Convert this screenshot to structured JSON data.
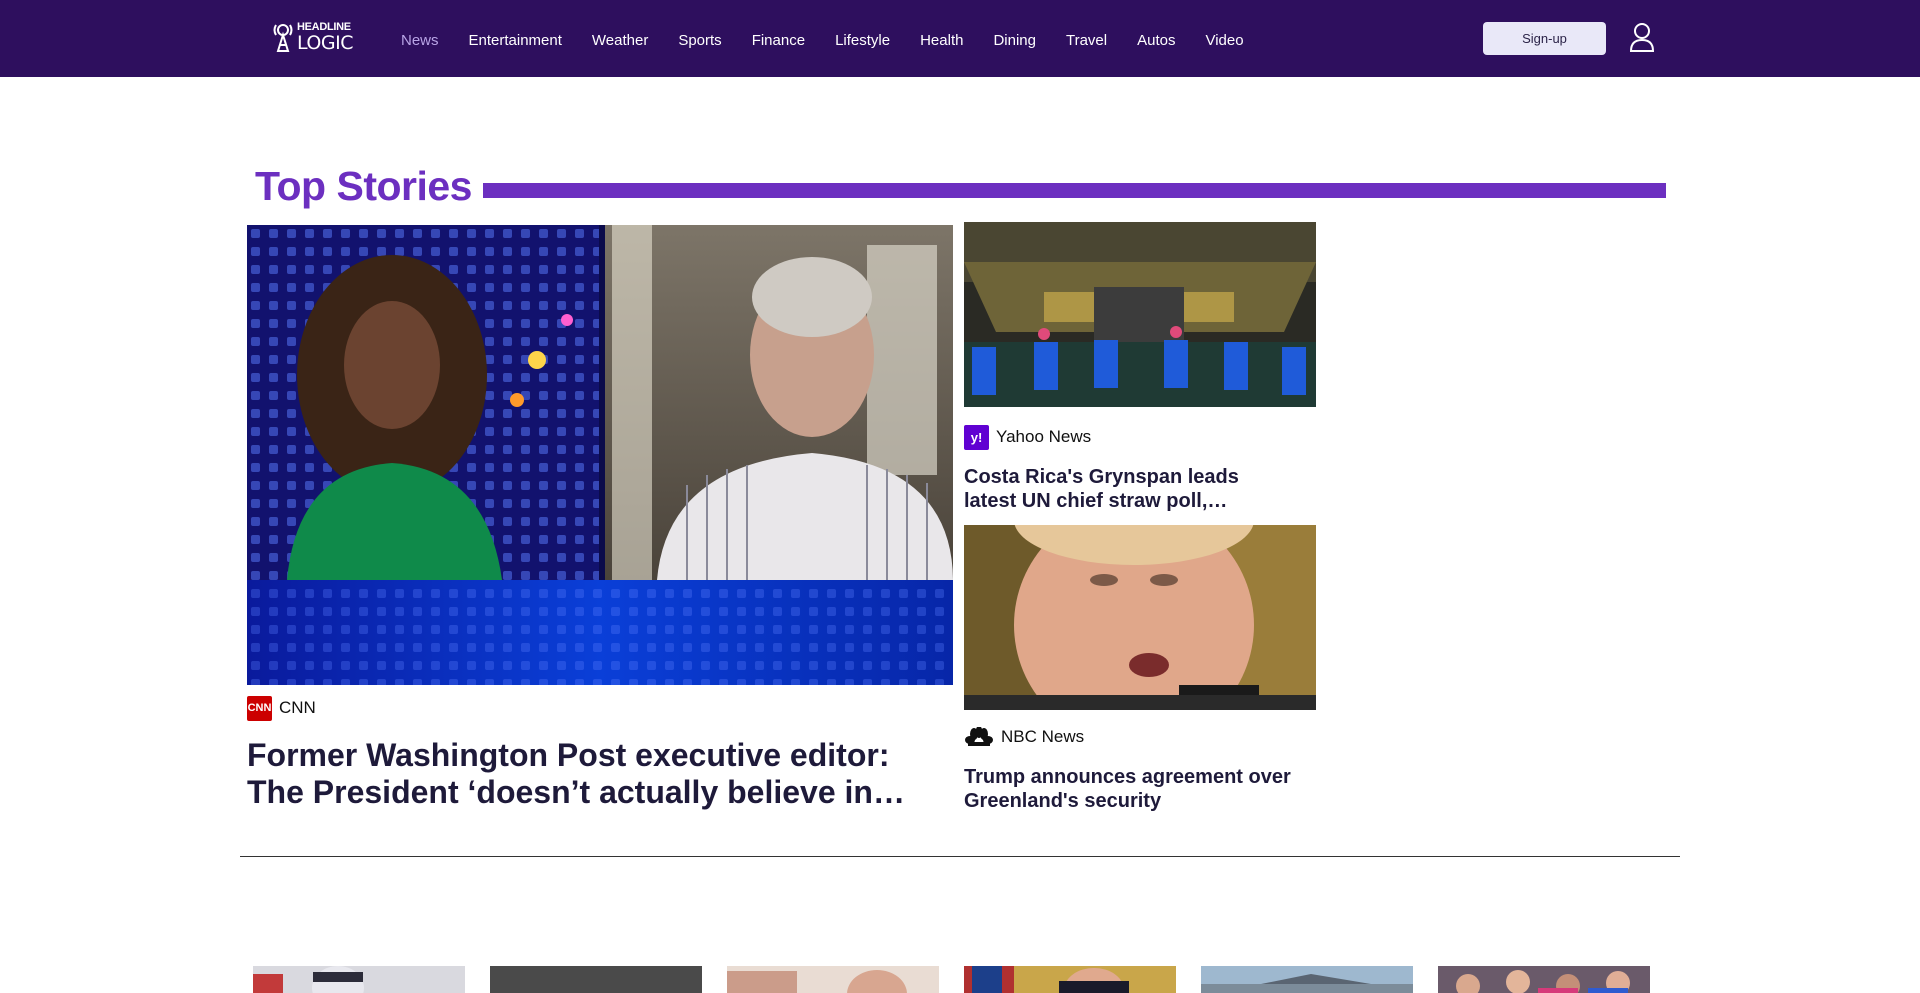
{
  "brand": {
    "line1": "HEADLINE",
    "line2": "LOGIC"
  },
  "nav": [
    {
      "label": "News",
      "active": true
    },
    {
      "label": "Entertainment"
    },
    {
      "label": "Weather"
    },
    {
      "label": "Sports"
    },
    {
      "label": "Finance"
    },
    {
      "label": "Lifestyle"
    },
    {
      "label": "Health"
    },
    {
      "label": "Dining"
    },
    {
      "label": "Travel"
    },
    {
      "label": "Autos"
    },
    {
      "label": "Video"
    }
  ],
  "signup_label": "Sign-up",
  "section": {
    "title": "Top Stories"
  },
  "stories": {
    "main": {
      "source": "CNN",
      "source_badge": "CNN",
      "headline": "Former Washington Post executive editor: The President ‘doesn’t actually believe in…"
    },
    "side1": {
      "source": "Yahoo News",
      "source_badge": "y!",
      "headline": "Costa Rica's Grynspan leads latest UN chief straw poll,…"
    },
    "side2": {
      "source": "NBC News",
      "headline": "Trump announces agreement over Greenland's security"
    }
  },
  "colors": {
    "header_bg": "#2e0f5e",
    "accent": "#6c2fc0",
    "nav_active": "#b9a5e6",
    "cnn_red": "#cc0000",
    "yahoo_purple": "#6001d2"
  },
  "icons": {
    "user": "user-icon",
    "logo": "logo-mark-icon",
    "nbc": "nbc-peacock-icon"
  }
}
